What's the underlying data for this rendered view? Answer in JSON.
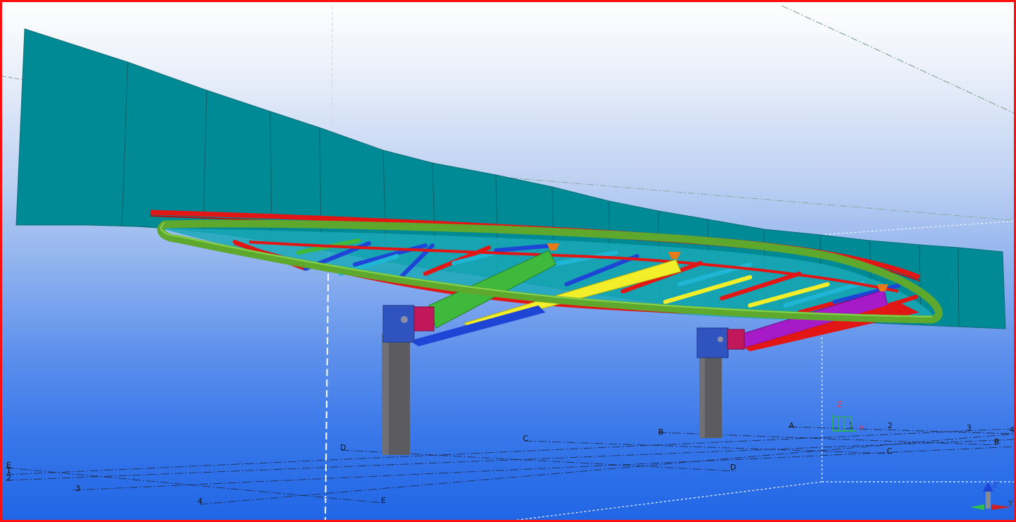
{
  "viewport": {
    "name": "3D model view",
    "border_color": "#ff1010"
  },
  "gridlines": {
    "left_labels": [
      "E",
      "1",
      "2",
      "3",
      "4"
    ],
    "near_labels": [
      "D",
      "E"
    ],
    "far_labels": [
      "C",
      "B",
      "A"
    ],
    "right_numbers": [
      "1",
      "2",
      "3",
      "4"
    ],
    "right_letters": [
      "B",
      "C",
      "D"
    ]
  },
  "axis_small": {
    "z": "Z",
    "y": "Y"
  },
  "axis_corner": {
    "z": "Z",
    "y": "Y"
  },
  "colors": {
    "wall_panel": "#008a95",
    "edge_tube": "#5ea82e",
    "red_member": "#e31616",
    "blue_member": "#1d45d6",
    "cyan_member": "#1fb5d4",
    "yellow_member": "#f2ee2a",
    "green_member": "#3fb93c",
    "magenta_member": "#a61ac8",
    "column": "#5b5b60",
    "bracket": "#2f54c0"
  }
}
